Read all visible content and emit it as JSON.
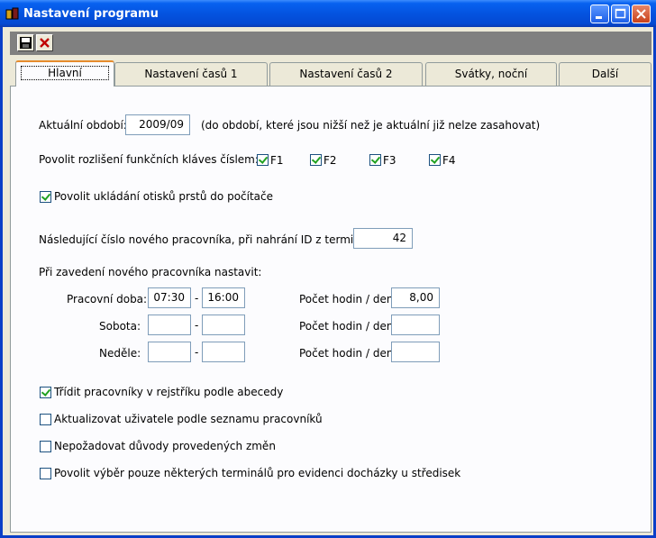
{
  "window": {
    "title": "Nastavení programu"
  },
  "tabs": [
    {
      "label": "Hlavní"
    },
    {
      "label": "Nastavení časů 1"
    },
    {
      "label": "Nastavení časů 2"
    },
    {
      "label": "Svátky, noční"
    },
    {
      "label": "Další"
    }
  ],
  "period": {
    "label": "Aktuální období:",
    "value": "2009/09",
    "note": "(do období, které jsou nižší než je aktuální již nelze zasahovat)"
  },
  "fkeys": {
    "label": "Povolit rozlišení funkčních kláves číslem:",
    "items": [
      {
        "label": "F1",
        "checked": true
      },
      {
        "label": "F2",
        "checked": true
      },
      {
        "label": "F3",
        "checked": true
      },
      {
        "label": "F4",
        "checked": true
      }
    ]
  },
  "fingerprints": {
    "label": "Povolit ukládání otisků prstů do počítače",
    "checked": true
  },
  "next_id": {
    "label": "Následující číslo nového pracovníka, při nahrání ID z terminálu:",
    "value": "42"
  },
  "new_worker": {
    "heading": "Při zavedení nového pracovníka nastavit:",
    "rows": [
      {
        "label": "Pracovní doba:",
        "from": "07:30",
        "to": "16:00",
        "hours_label": "Počet hodin / den:",
        "hours": "8,00"
      },
      {
        "label": "Sobota:",
        "from": "",
        "to": "",
        "hours_label": "Počet hodin / den:",
        "hours": ""
      },
      {
        "label": "Neděle:",
        "from": "",
        "to": "",
        "hours_label": "Počet hodin / den:",
        "hours": ""
      }
    ],
    "dash": "-"
  },
  "options": [
    {
      "label": "Třídit pracovníky v rejstříku podle abecedy",
      "checked": true
    },
    {
      "label": "Aktualizovat uživatele podle seznamu pracovníků",
      "checked": false
    },
    {
      "label": "Nepožadovat důvody provedených změn",
      "checked": false
    },
    {
      "label": "Povolit výběr pouze některých terminálů pro evidenci docházky u středisek",
      "checked": false
    }
  ]
}
